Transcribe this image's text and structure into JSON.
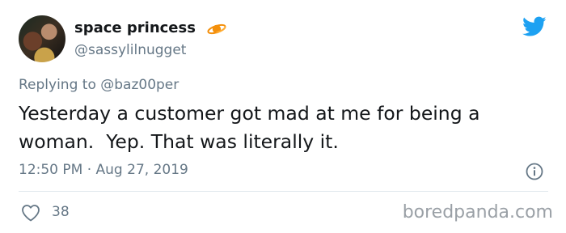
{
  "author": {
    "display_name": "space princess",
    "handle": "@sassylilnugget",
    "badge_icon": "planet-icon"
  },
  "reply": {
    "prefix": "Replying to ",
    "mention": "@baz00per"
  },
  "tweet": {
    "text": "Yesterday a customer got mad at me for being a woman.  Yep. That was literally it.",
    "timestamp": "12:50 PM · Aug 27, 2019"
  },
  "actions": {
    "like_count": "38"
  },
  "watermark": "boredpanda.com",
  "colors": {
    "text_primary": "#14171a",
    "text_secondary": "#657786",
    "twitter_blue": "#1da1f2",
    "planet_orange": "#f4900c",
    "divider": "#e1e8ed"
  }
}
